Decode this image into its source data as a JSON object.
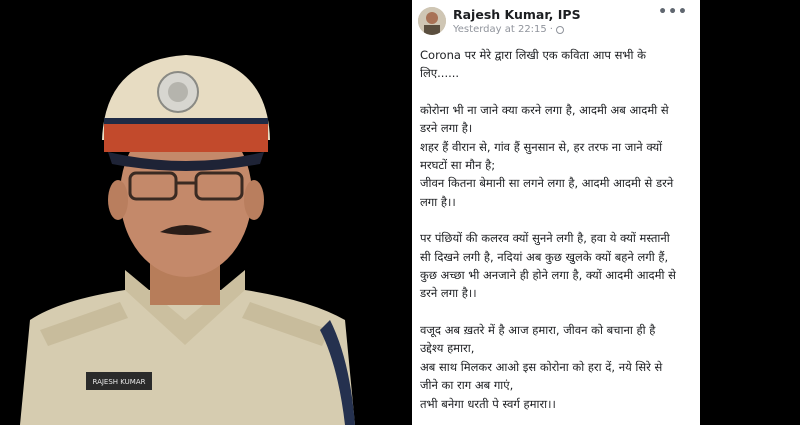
{
  "post": {
    "author": "Rajesh Kumar, IPS",
    "timestamp": "Yesterday at 22:15",
    "separator": "·",
    "more_label": "•••",
    "intro_lines": [
      "Corona पर मेरे द्वारा लिखी एक कविता आप सभी के",
      "लिए......"
    ],
    "stanza1": [
      "कोरोना भी ना जाने क्या करने लगा है, आदमी अब आदमी से",
      "डरने लगा है।",
      "शहर हैं वीरान से, गांव हैं सुनसान से, हर तरफ ना जाने क्यों",
      "मरघटों सा मौन है;",
      "जीवन कितना बेमानी सा लगने लगा है, आदमी आदमी से डरने",
      "लगा है।।"
    ],
    "stanza2": [
      "पर पंछियों की कलरव क्यों सुनने लगी है, हवा ये क्यों मस्तानी",
      "सी दिखने लगी है, नदियां अब कुछ खुलके क्यों बहने लगी हैं,",
      "कुछ अच्छा भी अनजाने ही होने लगा है, क्यों आदमी आदमी से",
      "डरने लगा है।।"
    ],
    "stanza3": [
      "वजूद अब ख़तरे में है आज हमारा, जीवन को बचाना ही है",
      "उद्देश्य हमारा,",
      "अब साथ मिलकर आओ इस कोरोना को हरा दें, नये सिरे से",
      "जीने का राग अब गाएं,",
      "तभी बनेगा धरती पे स्वर्ग हमारा।।"
    ]
  },
  "photo": {
    "name_tag": "RAJESH KUMAR"
  },
  "colors": {
    "text": "#1c1e21",
    "meta": "#90949c",
    "khaki": "#d8ccaa",
    "cap_band": "#c24a2c"
  }
}
